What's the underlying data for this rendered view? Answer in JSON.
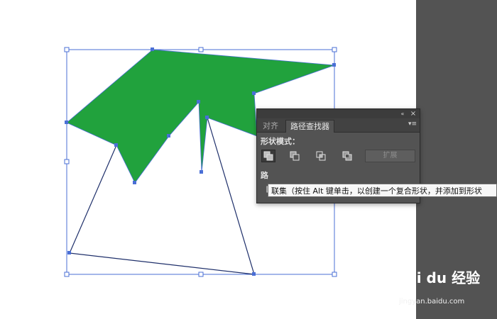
{
  "panel": {
    "tabs": [
      {
        "label": "对齐",
        "active": false
      },
      {
        "label": "路径查找器",
        "active": true
      }
    ],
    "collapse_icon": "«",
    "close_icon": "×",
    "menu_icon": "▾≡",
    "shape_modes_label": "形状模式：",
    "pathfinders_label": "路",
    "expand_label": "扩展"
  },
  "tooltip": {
    "text": "联集（按住 Alt 键单击，以创建一个复合形状，并添加到形状"
  },
  "watermark": {
    "brand": "Bai du 经验",
    "sub": "jingyan.baidu.com"
  },
  "colors": {
    "shape_fill": "#21a23d",
    "selection": "#4a6fd6",
    "panel_bg": "#535353",
    "pasteboard": "#535353"
  }
}
